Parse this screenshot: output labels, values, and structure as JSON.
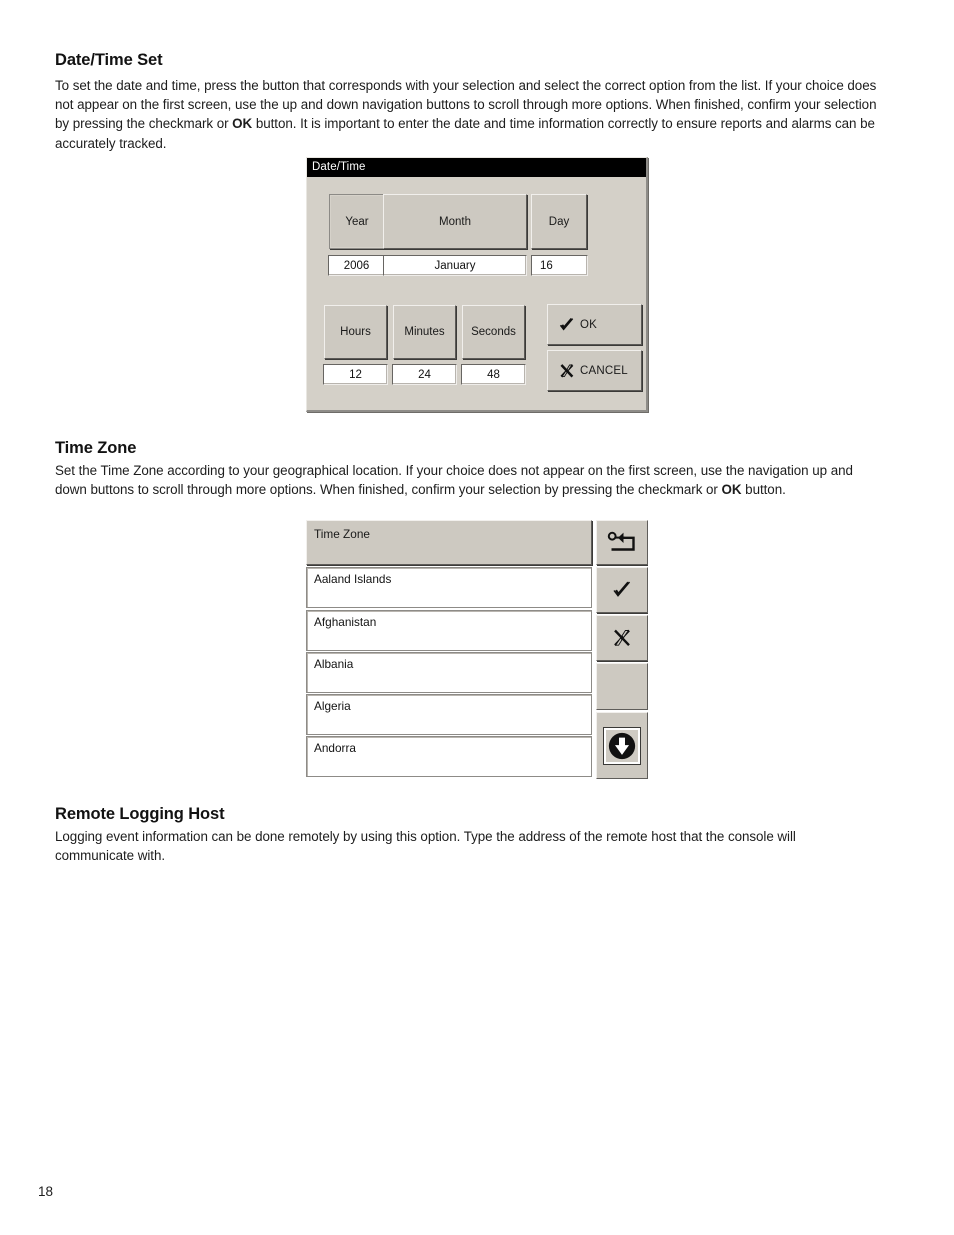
{
  "document": {
    "page_number": "18"
  },
  "sections": {
    "datetime": {
      "heading": "Date/Time Set",
      "paragraph_html": "To set the date and time, press the button that corresponds with your selection and select the correct option from the list. If your choice does not appear on the first screen, use the up and down navigation buttons to scroll through more options. When finished, confirm your selection by pressing the checkmark or <b>OK</b> button. It is important to enter the date and time information correctly to ensure reports and alarms can be accurately tracked."
    },
    "timezone": {
      "heading": "Time Zone",
      "paragraph_html": "Set the Time Zone according to your geographical location. If your choice does not appear on the first screen, use the navigation up and down buttons to scroll through more options. When finished, confirm your selection by pressing the checkmark or <b>OK</b> button."
    },
    "remote_logging": {
      "heading": "Remote Logging Host",
      "paragraph_html": "Logging event information can be done remotely by using this option. Type the address of the remote host that the console will communicate with."
    }
  },
  "datetime_dialog": {
    "title": "Date/Time",
    "date_buttons": [
      {
        "label": "Year",
        "value": "2006",
        "selected": true
      },
      {
        "label": "Month",
        "value": "January",
        "selected": false
      },
      {
        "label": "Day",
        "value": "16",
        "selected": false
      }
    ],
    "time_buttons": [
      {
        "label": "Hours",
        "value": "12"
      },
      {
        "label": "Minutes",
        "value": "24"
      },
      {
        "label": "Seconds",
        "value": "48"
      }
    ],
    "ok_button": {
      "label": "OK",
      "icon": "checkmark-icon"
    },
    "cancel_button": {
      "label": "CANCEL",
      "icon": "cross-x-icon"
    }
  },
  "timezone_widget": {
    "header_label": "Time Zone",
    "list_items": [
      "Aaland Islands",
      "Afghanistan",
      "Albania",
      "Algeria",
      "Andorra"
    ],
    "side_buttons": [
      {
        "icon": "escape-back-icon",
        "label": ""
      },
      {
        "icon": "checkmark-icon",
        "label": ""
      },
      {
        "icon": "cross-x-icon",
        "label": ""
      },
      {
        "icon": "blank-icon",
        "label": ""
      },
      {
        "icon": "scroll-down-icon",
        "label": ""
      }
    ]
  },
  "colors": {
    "widget_face": "#cdc9c1",
    "titlebar": "#000000",
    "field_background": "#ffffff",
    "text": "#1b1b1b"
  }
}
